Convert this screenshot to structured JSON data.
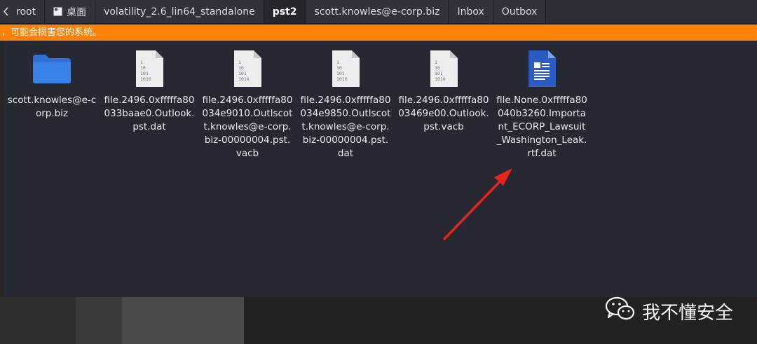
{
  "tabs": [
    {
      "label": "root",
      "icon": "arrow-left-icon",
      "active": false
    },
    {
      "label": "桌面",
      "icon": "desktop-icon",
      "active": false
    },
    {
      "label": "volatility_2.6_lin64_standalone",
      "active": false
    },
    {
      "label": "pst2",
      "active": true
    },
    {
      "label": "scott.knowles@e-corp.biz",
      "active": false
    },
    {
      "label": "Inbox",
      "active": false
    },
    {
      "label": "Outbox",
      "active": false
    }
  ],
  "warning": {
    "text": "，可能会损害您的系统。"
  },
  "files": [
    {
      "label": "scott.knowles@e-corp.biz",
      "icon": "folder-icon"
    },
    {
      "label": "file.2496.0xfffffa80033baae0.Outlook.pst.dat",
      "icon": "binary-file-icon"
    },
    {
      "label": "file.2496.0xfffffa80034e9010.Outlscott.knowles@e-corp.biz-00000004.pst.vacb",
      "icon": "binary-file-icon"
    },
    {
      "label": "file.2496.0xfffffa80034e9850.Outlscott.knowles@e-corp.biz-00000004.pst.dat",
      "icon": "binary-file-icon"
    },
    {
      "label": "file.2496.0xfffffa8003469e00.Outlook.pst.vacb",
      "icon": "binary-file-icon"
    },
    {
      "label": "file.None.0xfffffa80040b3260.Important_ECORP_Lawsuit_Washington_Leak.rtf.dat",
      "icon": "document-icon"
    }
  ],
  "watermark": {
    "text": "我不懂安全",
    "icon": "wechat-icon"
  },
  "colors": {
    "warning": "#ff8207",
    "arrow": "#e8231c",
    "folder": "#3b82e8",
    "document": "#2b5cc4"
  }
}
